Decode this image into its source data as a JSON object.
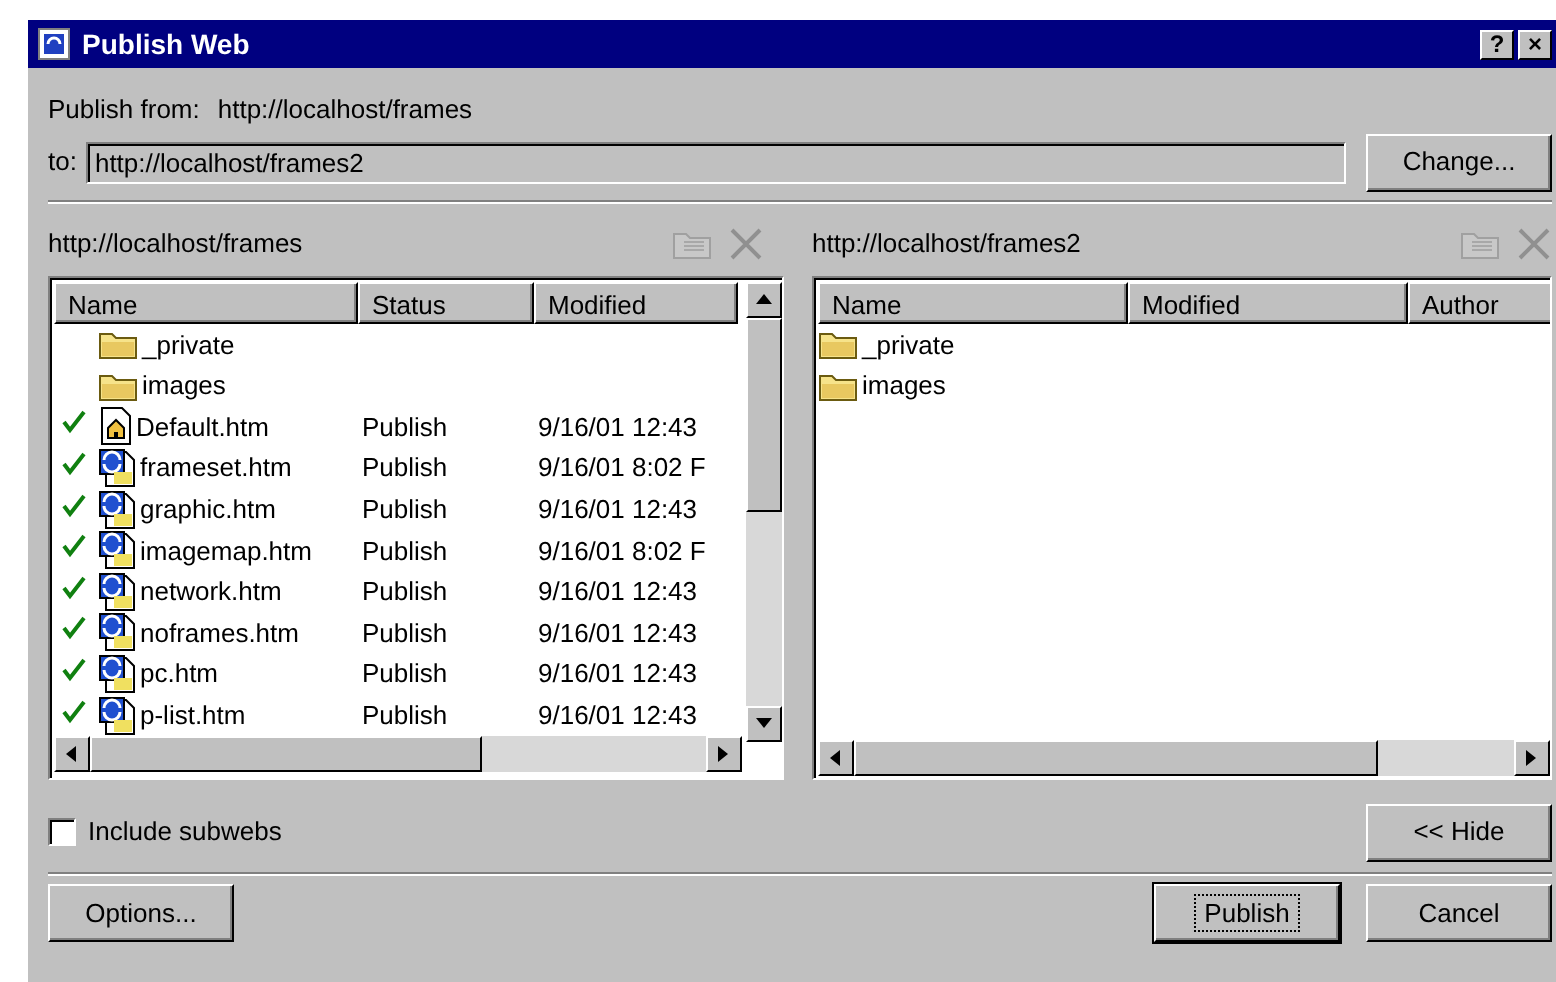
{
  "window": {
    "title": "Publish Web",
    "help_button": "?",
    "close_button": "×"
  },
  "publish_from": {
    "label": "Publish from:",
    "url": "http://localhost/frames"
  },
  "to": {
    "label": "to:",
    "value": "http://localhost/frames2"
  },
  "change_button": "Change...",
  "source": {
    "url": "http://localhost/frames",
    "columns": [
      "Name",
      "Status",
      "Modified"
    ],
    "rows": [
      {
        "kind": "folder",
        "checked": false,
        "cells": [
          "_private",
          "",
          ""
        ]
      },
      {
        "kind": "folder",
        "checked": false,
        "cells": [
          "images",
          "",
          ""
        ]
      },
      {
        "kind": "home-page",
        "checked": true,
        "cells": [
          "Default.htm",
          "Publish",
          "9/16/01 12:43"
        ]
      },
      {
        "kind": "frames-page",
        "checked": true,
        "cells": [
          "frameset.htm",
          "Publish",
          "9/16/01 8:02 F"
        ]
      },
      {
        "kind": "frames-page",
        "checked": true,
        "cells": [
          "graphic.htm",
          "Publish",
          "9/16/01 12:43"
        ]
      },
      {
        "kind": "frames-page",
        "checked": true,
        "cells": [
          "imagemap.htm",
          "Publish",
          "9/16/01 8:02 F"
        ]
      },
      {
        "kind": "frames-page",
        "checked": true,
        "cells": [
          "network.htm",
          "Publish",
          "9/16/01 12:43"
        ]
      },
      {
        "kind": "frames-page",
        "checked": true,
        "cells": [
          "noframes.htm",
          "Publish",
          "9/16/01 12:43"
        ]
      },
      {
        "kind": "frames-page",
        "checked": true,
        "cells": [
          "pc.htm",
          "Publish",
          "9/16/01 12:43"
        ]
      },
      {
        "kind": "frames-page",
        "checked": true,
        "cells": [
          "p-list.htm",
          "Publish",
          "9/16/01 12:43"
        ]
      }
    ]
  },
  "destination": {
    "url": "http://localhost/frames2",
    "columns": [
      "Name",
      "Modified",
      "Author"
    ],
    "rows": [
      {
        "kind": "folder",
        "cells": [
          "_private",
          "",
          ""
        ]
      },
      {
        "kind": "folder",
        "cells": [
          "images",
          "",
          ""
        ]
      }
    ]
  },
  "include_subwebs": {
    "label": "Include subwebs",
    "checked": false
  },
  "hide_button": "<< Hide",
  "options_button": "Options...",
  "publish_button": "Publish",
  "cancel_button": "Cancel"
}
